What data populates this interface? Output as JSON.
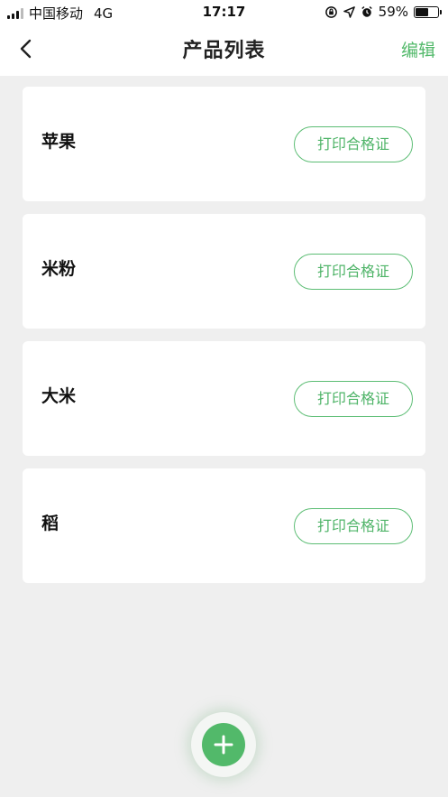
{
  "status_bar": {
    "carrier": "中国移动",
    "network": "4G",
    "time": "17:17",
    "battery_percent": "59%",
    "battery_level": 0.59
  },
  "nav": {
    "title": "产品列表",
    "edit_label": "编辑"
  },
  "products": [
    {
      "name": "苹果",
      "button_label": "打印合格证"
    },
    {
      "name": "米粉",
      "button_label": "打印合格证"
    },
    {
      "name": "大米",
      "button_label": "打印合格证"
    },
    {
      "name": "稻",
      "button_label": "打印合格证"
    }
  ],
  "colors": {
    "accent": "#52b96a",
    "background": "#efefef",
    "card": "#ffffff"
  },
  "icons": {
    "back": "chevron-left-icon",
    "add": "plus-icon"
  }
}
